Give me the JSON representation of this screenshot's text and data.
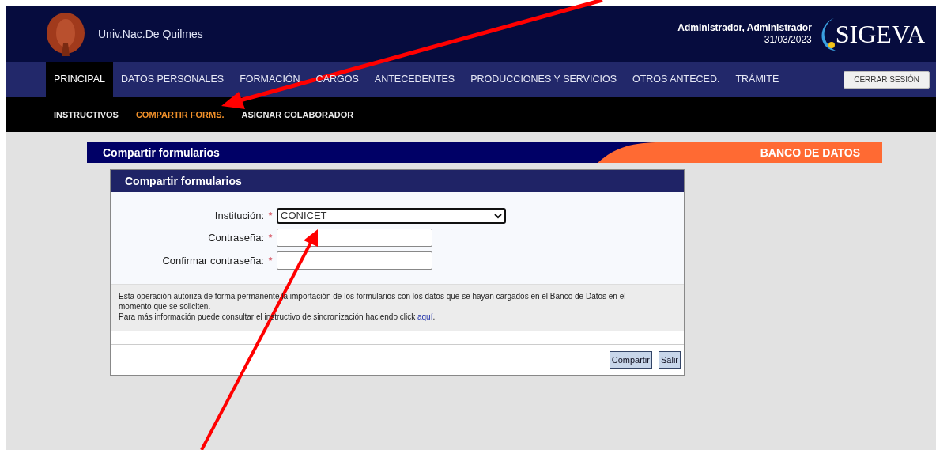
{
  "header": {
    "institution": "Univ.Nac.De Quilmes",
    "user": "Administrador, Administrador",
    "date": "31/03/2023",
    "brand": "SIGEVA"
  },
  "nav": [
    {
      "label": "PRINCIPAL",
      "selected": true
    },
    {
      "label": "DATOS PERSONALES",
      "selected": false
    },
    {
      "label": "FORMACIÓN",
      "selected": false
    },
    {
      "label": "CARGOS",
      "selected": false
    },
    {
      "label": "ANTECEDENTES",
      "selected": false
    },
    {
      "label": "PRODUCCIONES Y SERVICIOS",
      "selected": false
    },
    {
      "label": "OTROS ANTECED.",
      "selected": false
    },
    {
      "label": "TRÁMITE",
      "selected": false
    }
  ],
  "logout": "CERRAR SESIÓN",
  "subnav": [
    {
      "label": "INSTRUCTIVOS",
      "selected": false
    },
    {
      "label": "COMPARTIR FORMS.",
      "selected": true
    },
    {
      "label": "ASIGNAR COLABORADOR",
      "selected": false
    }
  ],
  "banner": {
    "title": "Compartir formularios",
    "section": "BANCO DE DATOS"
  },
  "panel": {
    "title": "Compartir formularios",
    "fields": [
      {
        "label": "Institución:",
        "kind": "select",
        "required": true,
        "required_mark": "*",
        "value": "CONICET"
      },
      {
        "label": "Contraseña:",
        "kind": "input",
        "required": true,
        "required_mark": "*"
      },
      {
        "label": "Confirmar contraseña:",
        "kind": "input",
        "required": true,
        "required_mark": "*"
      }
    ],
    "info": "Esta operación autoriza de forma permanente la importación de los formularios con los datos que se hayan cargados en el Banco de Datos en el momento que se soliciten.",
    "info_more": "Para más información puede consultar el instructivo de sincronización haciendo click",
    "info_link": "aquí",
    "info_end": ".",
    "buttons": [
      "Compartir",
      "Salir"
    ]
  }
}
